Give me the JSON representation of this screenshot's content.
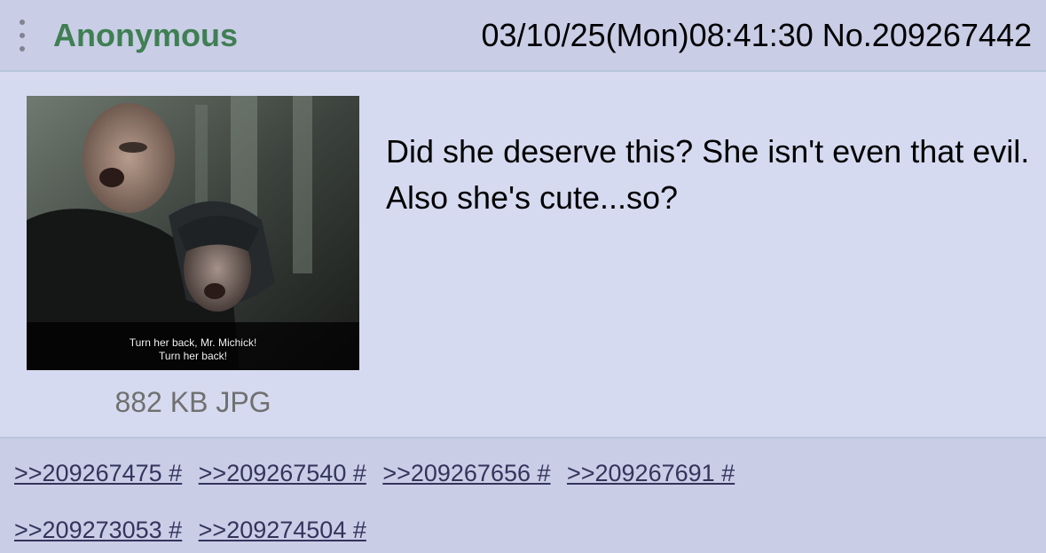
{
  "header": {
    "name": "Anonymous",
    "datetime": "03/10/25(Mon)08:41:30",
    "post_number": "No.209267442",
    "menu_icon": "vertical-dots-icon"
  },
  "thumbnail": {
    "subtitle_line1": "Turn her back, Mr. Michick!",
    "subtitle_line2": "Turn her back!",
    "file_info": "882 KB JPG"
  },
  "comment": {
    "text": "Did she deserve this? She isn't even that evil. Also she's cute...so?"
  },
  "replies": {
    "row1": [
      ">>209267475 #",
      ">>209267540 #",
      ">>209267656 #",
      ">>209267691 #"
    ],
    "row2": [
      ">>209273053 #",
      ">>209274504 #"
    ]
  },
  "colors": {
    "header_bg": "#c9cde6",
    "body_bg": "#d6daf0",
    "name": "#3f7f52",
    "link": "#34345c"
  }
}
